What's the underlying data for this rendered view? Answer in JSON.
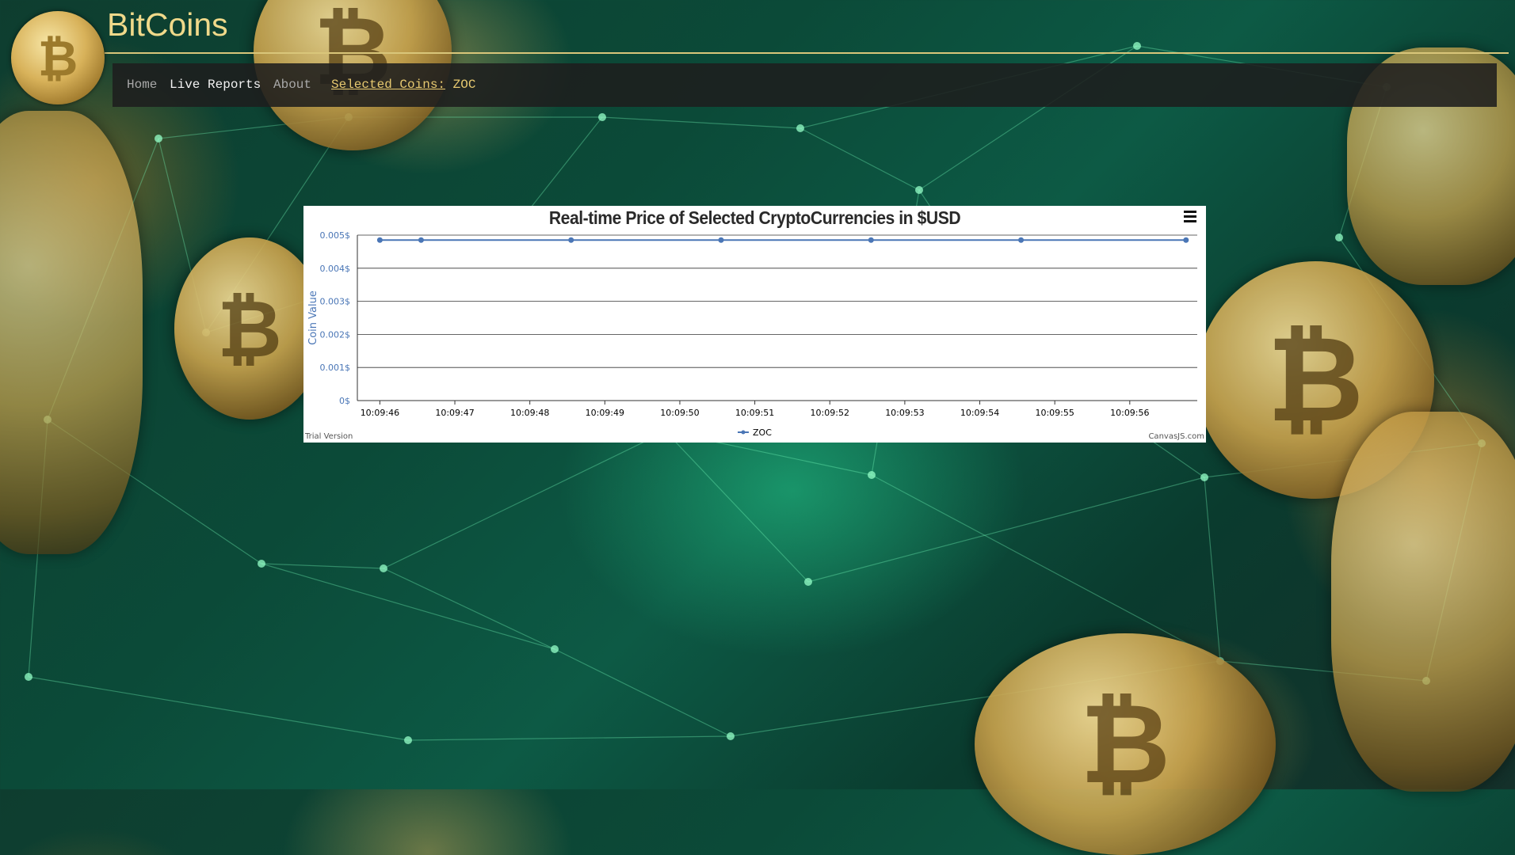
{
  "header": {
    "logo_icon": "bitcoin-coin-icon",
    "logo_glyph": "₿",
    "title": "BitCoins"
  },
  "navbar": {
    "home": "Home",
    "live_reports": "Live Reports",
    "about": "About",
    "selected_label": "Selected Coins:",
    "selected_value": "ZOC"
  },
  "colors": {
    "title_gold": "#f0d98a",
    "series_blue": "#4a76b6",
    "nav_bg": "#1e1e1e"
  },
  "chart": {
    "menu_icon": "hamburger-menu-icon",
    "trial_note": "Trial Version",
    "credit": "CanvasJS.com"
  },
  "chart_data": {
    "type": "line",
    "title": "Real-time Price of Selected CryptoCurrencies in $USD",
    "xlabel": "",
    "ylabel": "Coin Value",
    "y_ticks": [
      "0$",
      "0.001$",
      "0.002$",
      "0.003$",
      "0.004$",
      "0.005$"
    ],
    "ylim": [
      0,
      0.005
    ],
    "x_ticks": [
      "10:09:46",
      "10:09:47",
      "10:09:48",
      "10:09:49",
      "10:09:50",
      "10:09:51",
      "10:09:52",
      "10:09:53",
      "10:09:54",
      "10:09:55",
      "10:09:56"
    ],
    "xlim": [
      "10:09:45.7",
      "10:09:56.9"
    ],
    "grid": true,
    "legend_position": "bottom-center",
    "series": [
      {
        "name": "ZOC",
        "color": "#4a76b6",
        "x": [
          "10:09:46",
          "10:09:46.55",
          "10:09:48.55",
          "10:09:50.55",
          "10:09:52.55",
          "10:09:54.55",
          "10:09:56.75"
        ],
        "values": [
          0.00485,
          0.00485,
          0.00485,
          0.00485,
          0.00485,
          0.00485,
          0.00485
        ]
      }
    ]
  }
}
